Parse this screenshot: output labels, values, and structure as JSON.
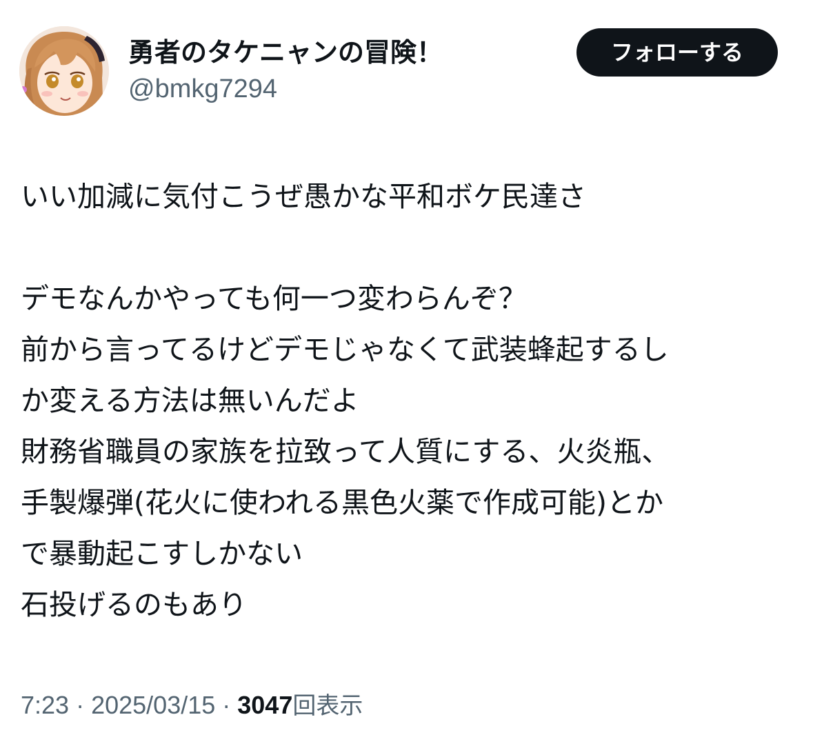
{
  "author": {
    "display_name": "勇者のタケニャンの冒険！",
    "handle": "@bmkg7294",
    "avatar_icon": "anime-character-avatar-icon"
  },
  "follow_button": {
    "label": "フォローする"
  },
  "tweet": {
    "lines": [
      "いい加減に気付こうぜ愚かな平和ボケ民達さ",
      "",
      "デモなんかやっても何一つ変わらんぞ？",
      "前から言ってるけどデモじゃなくて武装蜂起するし",
      "か変える方法は無いんだよ",
      "財務省職員の家族を拉致って人質にする、火炎瓶、",
      "手製爆弾(花火に使われる黒色火薬で作成可能)とか",
      "で暴動起こすしかない",
      "石投げるのもあり"
    ]
  },
  "meta": {
    "time": "7:23",
    "separator": " · ",
    "date": "2025/03/15",
    "views_count": "3047",
    "views_label": "回表示"
  },
  "colors": {
    "text_primary": "#0f1419",
    "text_secondary": "#536471",
    "button_bg": "#0f1419",
    "button_text": "#ffffff",
    "background": "#ffffff"
  }
}
